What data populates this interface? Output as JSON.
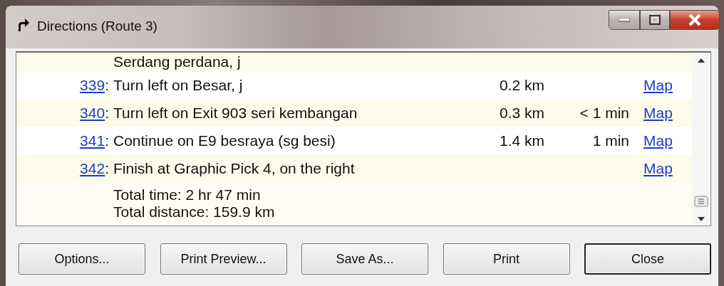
{
  "window": {
    "title": "Directions (Route 3)"
  },
  "directions": [
    {
      "instruction": "Serdang perdana, j"
    },
    {
      "step": "339",
      "separator": ":",
      "instruction": "Turn left on Besar, j",
      "distance": "0.2 km",
      "link": "Map"
    },
    {
      "step": "340",
      "separator": ":",
      "instruction": "Turn left on Exit 903 seri kembangan",
      "distance": "0.3 km",
      "time": "< 1 min",
      "link": "Map"
    },
    {
      "step": "341",
      "separator": ":",
      "instruction": "Continue on E9 besraya (sg besi)",
      "distance": "1.4 km",
      "time": "1 min",
      "link": "Map"
    },
    {
      "step": "342",
      "separator": ":",
      "instruction": "Finish at Graphic Pick 4, on the right",
      "link": "Map"
    }
  ],
  "totals": [
    "Total time: 2 hr 47 min",
    "Total distance: 159.9 km"
  ],
  "buttons": [
    {
      "label": "Options...",
      "default": false
    },
    {
      "label": "Print Preview...",
      "default": false
    },
    {
      "label": "Save As...",
      "default": false
    },
    {
      "label": "Print",
      "default": false
    },
    {
      "label": "Close",
      "default": true
    }
  ]
}
